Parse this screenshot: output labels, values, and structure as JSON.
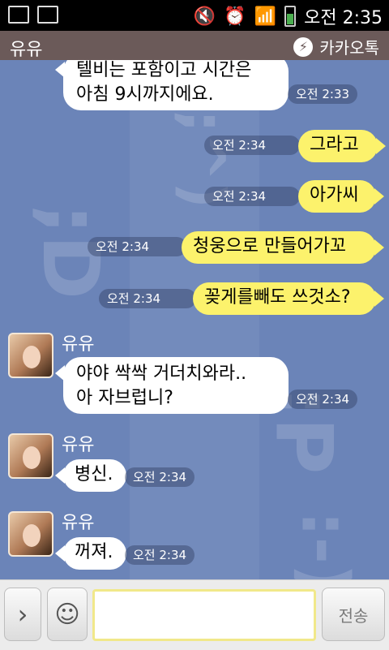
{
  "status": {
    "time": "오전 2:35"
  },
  "header": {
    "title": "유유",
    "brand": "카카오톡"
  },
  "messages": [
    {
      "side": "in",
      "text1": "텔비는 포함이고 시간은",
      "text2": "아침 9시까지에요.",
      "time": "오전 2:33"
    },
    {
      "side": "out",
      "text": "그라고",
      "time": "오전 2:34"
    },
    {
      "side": "out",
      "text": "아가씨",
      "time": "오전 2:34"
    },
    {
      "side": "out",
      "text": "청웅으로 만들어가꼬",
      "time": "오전 2:34"
    },
    {
      "side": "out",
      "text": "꽂게를빼도 쓰것소?",
      "time": "오전 2:34"
    },
    {
      "side": "in",
      "sender": "유유",
      "text1": "야야 싹싹 거더치와라..",
      "text2": "아 자브럽니?",
      "time": "오전 2:34"
    },
    {
      "side": "in",
      "sender": "유유",
      "text": "병신.",
      "time": "오전 2:34"
    },
    {
      "side": "in",
      "sender": "유유",
      "text": "꺼져.",
      "time": "오전 2:34"
    }
  ],
  "bottom": {
    "send_label": "전송",
    "input_value": ""
  }
}
